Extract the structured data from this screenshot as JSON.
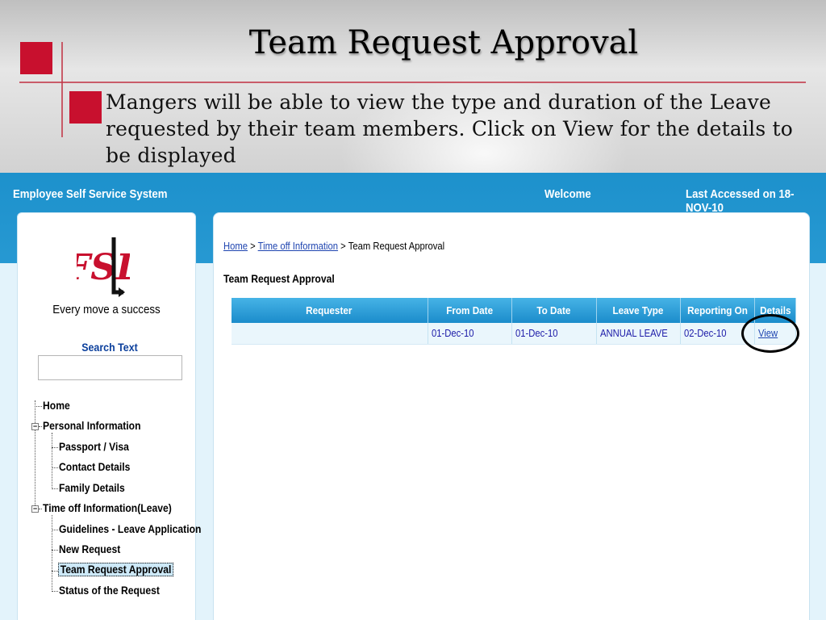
{
  "slide": {
    "title": "Team Request Approval",
    "body": "Mangers will be able to view the type and duration of the Leave requested by their team members. Click on View for the details to be displayed",
    "accent_color": "#c8102e"
  },
  "app": {
    "title": "Employee Self Service System",
    "welcome": "Welcome",
    "last_accessed": "Last Accessed on 18-NOV-10",
    "header_color": "#1d91cc",
    "logo_text": "FSL",
    "tagline": "Every move a success",
    "search": {
      "label": "Search Text",
      "value": ""
    },
    "nav": {
      "home": "Home",
      "personal_information": "Personal Information",
      "passport_visa": "Passport / Visa",
      "contact_details": "Contact Details",
      "family_details": "Family Details",
      "time_off": "Time off Information(Leave)",
      "guidelines": "Guidelines - Leave Application",
      "new_request": "New Request",
      "team_request_approval": "Team Request Approval",
      "status_of_request": "Status of the Request",
      "expander_symbol": "−"
    },
    "breadcrumb": {
      "home": "Home",
      "sep": " > ",
      "time_off": "Time off Information",
      "current": "Team Request Approval"
    },
    "section_title": "Team Request Approval",
    "table": {
      "headers": [
        "Requester",
        "From Date",
        "To Date",
        "Leave Type",
        "Reporting On",
        "Details"
      ],
      "rows": [
        {
          "requester": "",
          "from_date": "01-Dec-10",
          "to_date": "01-Dec-10",
          "leave_type": "ANNUAL LEAVE",
          "reporting_on": "02-Dec-10",
          "details": "View"
        }
      ]
    }
  }
}
